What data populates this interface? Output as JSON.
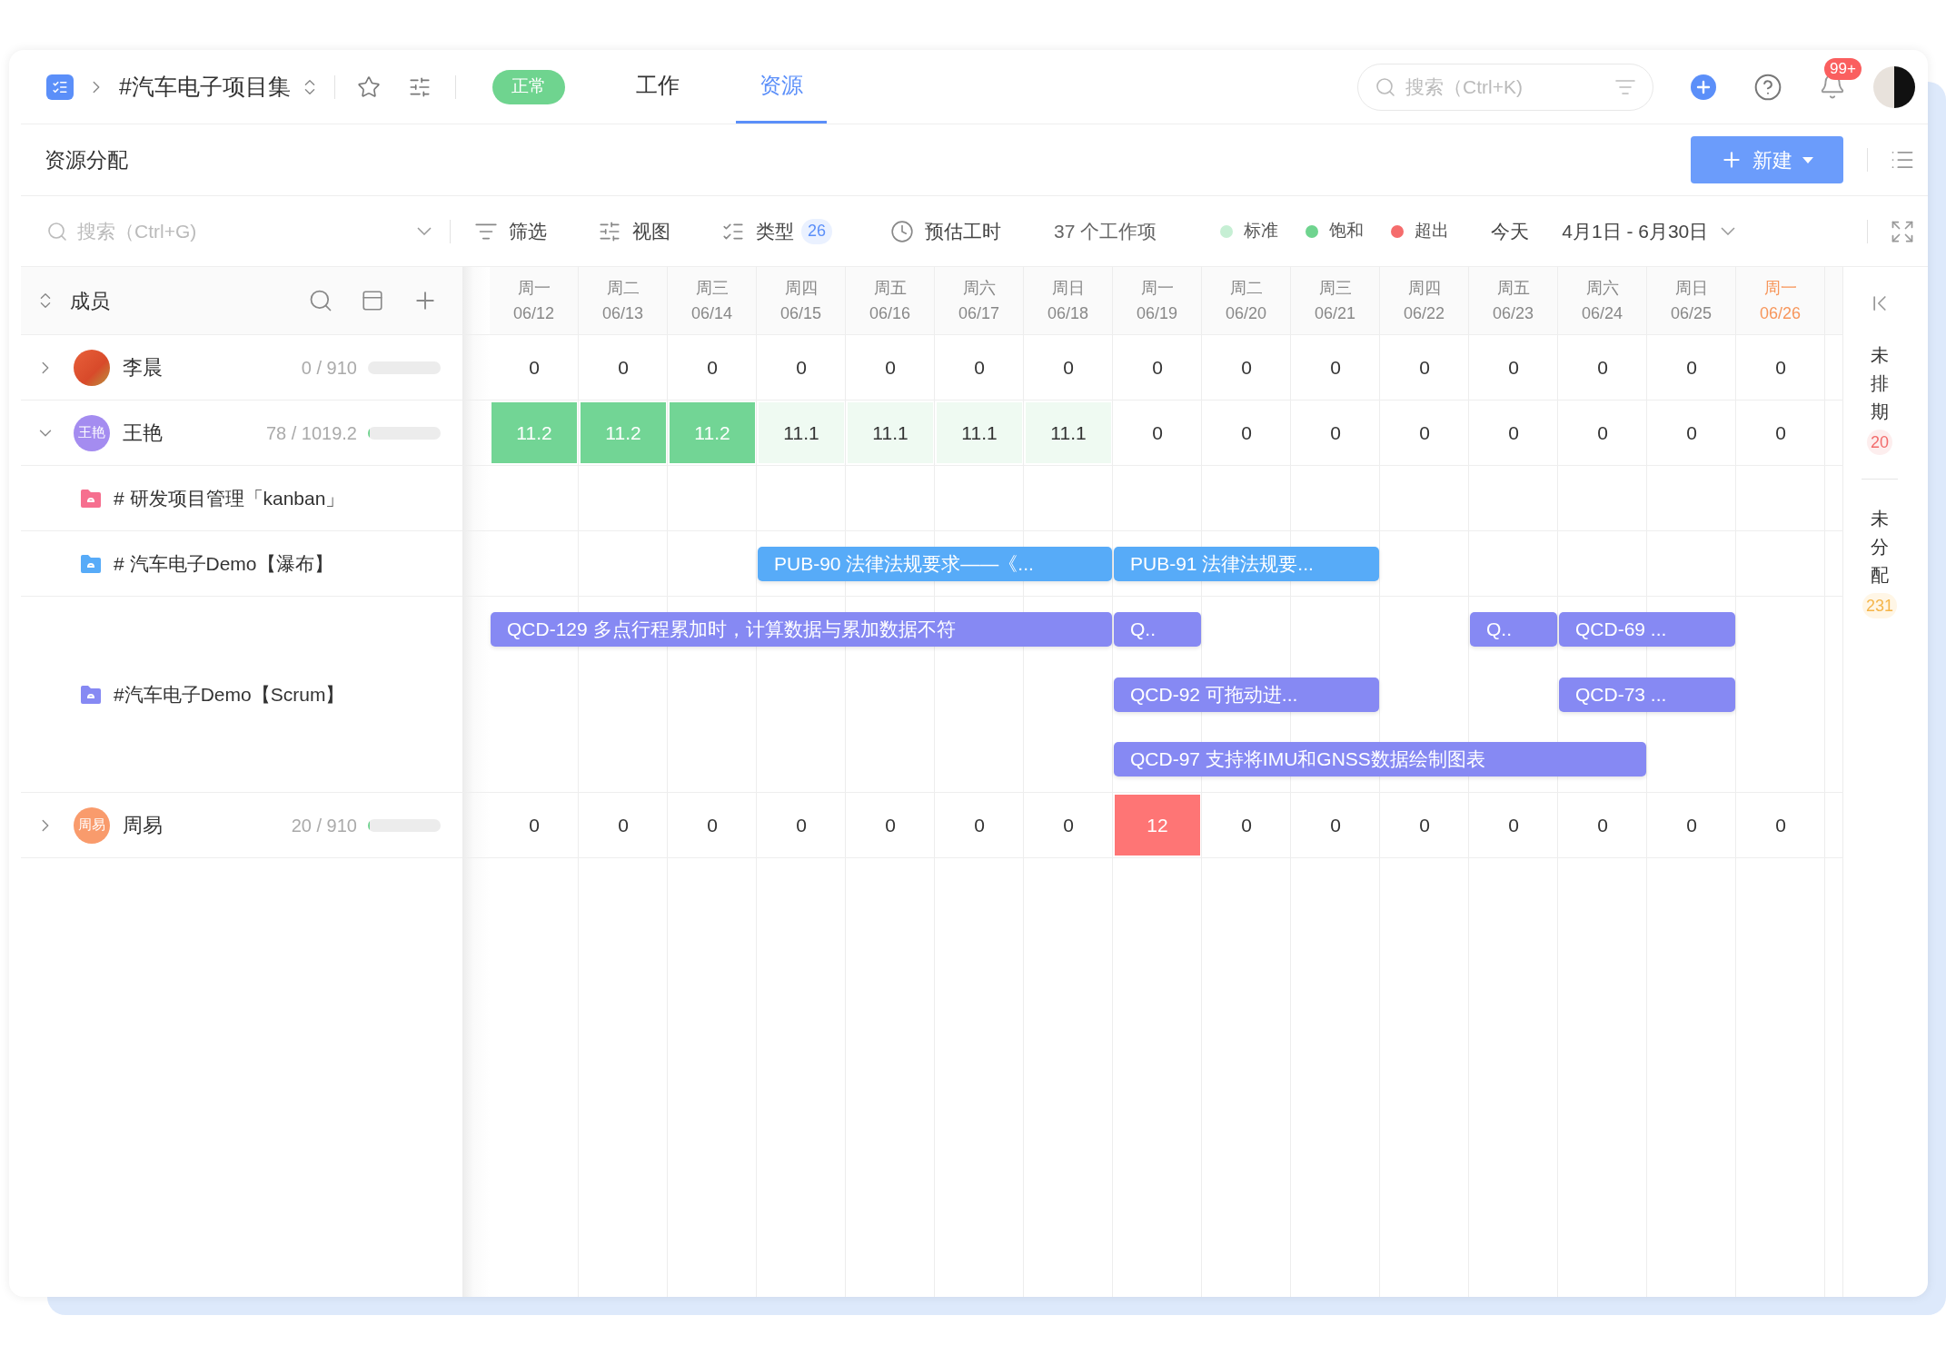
{
  "header": {
    "title": "#汽车电子项目集",
    "status": "正常",
    "tabs": [
      {
        "label": "工作",
        "selected": false
      },
      {
        "label": "资源",
        "selected": true
      }
    ],
    "search": {
      "placeholder": "搜索（Ctrl+K)"
    },
    "notification_badge": "99+"
  },
  "page_title": "资源分配",
  "new_button": "新建",
  "toolbar": {
    "search": {
      "placeholder": "搜索（Ctrl+G)"
    },
    "filter": "筛选",
    "view": "视图",
    "type": {
      "label": "类型",
      "count": "26"
    },
    "estimate": "预估工时",
    "item_count": "37 个工作项",
    "legend": [
      {
        "label": "标准",
        "color": "#c6efd4"
      },
      {
        "label": "饱和",
        "color": "#6fd48f"
      },
      {
        "label": "超出",
        "color": "#f56c6c"
      }
    ],
    "today": "今天",
    "date_range": "4月1日 - 6月30日"
  },
  "members_header": "成员",
  "days": [
    {
      "weekday": "周一",
      "date": "06/12",
      "today": false
    },
    {
      "weekday": "周二",
      "date": "06/13",
      "today": false
    },
    {
      "weekday": "周三",
      "date": "06/14",
      "today": false
    },
    {
      "weekday": "周四",
      "date": "06/15",
      "today": false
    },
    {
      "weekday": "周五",
      "date": "06/16",
      "today": false
    },
    {
      "weekday": "周六",
      "date": "06/17",
      "today": false
    },
    {
      "weekday": "周日",
      "date": "06/18",
      "today": false
    },
    {
      "weekday": "周一",
      "date": "06/19",
      "today": false
    },
    {
      "weekday": "周二",
      "date": "06/20",
      "today": false
    },
    {
      "weekday": "周三",
      "date": "06/21",
      "today": false
    },
    {
      "weekday": "周四",
      "date": "06/22",
      "today": false
    },
    {
      "weekday": "周五",
      "date": "06/23",
      "today": false
    },
    {
      "weekday": "周六",
      "date": "06/24",
      "today": false
    },
    {
      "weekday": "周日",
      "date": "06/25",
      "today": false
    },
    {
      "weekday": "周一",
      "date": "06/26",
      "today": true
    }
  ],
  "members": [
    {
      "name": "李晨",
      "avatar": {
        "kind": "photo"
      },
      "hours": "0 / 910",
      "expanded": false,
      "cells": [
        {
          "value": "0"
        },
        {
          "value": "0"
        },
        {
          "value": "0"
        },
        {
          "value": "0"
        },
        {
          "value": "0"
        },
        {
          "value": "0"
        },
        {
          "value": "0"
        },
        {
          "value": "0"
        },
        {
          "value": "0"
        },
        {
          "value": "0"
        },
        {
          "value": "0"
        },
        {
          "value": "0"
        },
        {
          "value": "0"
        },
        {
          "value": "0"
        },
        {
          "value": "0"
        }
      ]
    },
    {
      "name": "王艳",
      "avatar": {
        "kind": "initials",
        "text": "王艳",
        "color": "#a48cf0"
      },
      "hours": "78 / 1019.2",
      "level": 0.03,
      "expanded": true,
      "cells": [
        {
          "value": "11.2",
          "kind": "saturated"
        },
        {
          "value": "11.2",
          "kind": "saturated"
        },
        {
          "value": "11.2",
          "kind": "saturated"
        },
        {
          "value": "11.1",
          "kind": "standard"
        },
        {
          "value": "11.1",
          "kind": "standard"
        },
        {
          "value": "11.1",
          "kind": "standard"
        },
        {
          "value": "11.1",
          "kind": "standard"
        },
        {
          "value": "0"
        },
        {
          "value": "0"
        },
        {
          "value": "0"
        },
        {
          "value": "0"
        },
        {
          "value": "0"
        },
        {
          "value": "0"
        },
        {
          "value": "0"
        },
        {
          "value": "0"
        }
      ],
      "projects": [
        {
          "name": "# 研发项目管理「kanban」",
          "color": "#f66f8f"
        },
        {
          "name": "# 汽车电子Demo【瀑布】",
          "color": "#57abf8",
          "lanes": [
            [
              {
                "kind": "empty"
              },
              {
                "kind": "empty"
              },
              {
                "kind": "empty"
              },
              {
                "kind": "bar",
                "label": "PUB-90 法律法规要求——《..."
              },
              {
                "kind": "more"
              },
              {
                "kind": "more"
              },
              {
                "kind": "more"
              },
              {
                "kind": "bar",
                "label": "PUB-91 法律法规要..."
              },
              {
                "kind": "more"
              },
              {
                "kind": "more"
              },
              {
                "kind": "empty"
              },
              {
                "kind": "empty"
              },
              {
                "kind": "empty"
              },
              {
                "kind": "empty"
              },
              {
                "kind": "empty"
              }
            ]
          ]
        },
        {
          "name": "#汽车电子Demo【Scrum】",
          "color": "#8689f3",
          "lanes": [
            [
              {
                "kind": "bar",
                "label": "QCD-129 多点行程累加时，计算数据与累加数据不符"
              },
              {
                "kind": "more"
              },
              {
                "kind": "more"
              },
              {
                "kind": "more"
              },
              {
                "kind": "more"
              },
              {
                "kind": "more"
              },
              {
                "kind": "more"
              },
              {
                "kind": "bar",
                "label": "Q.."
              },
              {
                "kind": "empty"
              },
              {
                "kind": "empty"
              },
              {
                "kind": "empty"
              },
              {
                "kind": "bar",
                "label": "Q.."
              },
              {
                "kind": "bar",
                "label": "QCD-69 ..."
              },
              {
                "kind": "more"
              },
              {
                "kind": "empty"
              }
            ],
            [
              {
                "kind": "empty"
              },
              {
                "kind": "empty"
              },
              {
                "kind": "empty"
              },
              {
                "kind": "empty"
              },
              {
                "kind": "empty"
              },
              {
                "kind": "empty"
              },
              {
                "kind": "empty"
              },
              {
                "kind": "bar",
                "label": "QCD-92 可拖动进..."
              },
              {
                "kind": "more"
              },
              {
                "kind": "more"
              },
              {
                "kind": "empty"
              },
              {
                "kind": "empty"
              },
              {
                "kind": "bar",
                "label": "QCD-73 ..."
              },
              {
                "kind": "more"
              },
              {
                "kind": "empty"
              }
            ],
            [
              {
                "kind": "empty"
              },
              {
                "kind": "empty"
              },
              {
                "kind": "empty"
              },
              {
                "kind": "empty"
              },
              {
                "kind": "empty"
              },
              {
                "kind": "empty"
              },
              {
                "kind": "empty"
              },
              {
                "kind": "bar",
                "label": "QCD-97 支持将IMU和GNSS数据绘制图表"
              },
              {
                "kind": "more"
              },
              {
                "kind": "more"
              },
              {
                "kind": "more"
              },
              {
                "kind": "more"
              },
              {
                "kind": "more"
              },
              {
                "kind": "empty"
              },
              {
                "kind": "empty"
              }
            ]
          ]
        }
      ]
    },
    {
      "name": "周易",
      "avatar": {
        "kind": "initials",
        "text": "周易",
        "color": "#f99b6c"
      },
      "hours": "20 / 910",
      "level": 0.03,
      "expanded": false,
      "cells": [
        {
          "value": "0"
        },
        {
          "value": "0"
        },
        {
          "value": "0"
        },
        {
          "value": "0"
        },
        {
          "value": "0"
        },
        {
          "value": "0"
        },
        {
          "value": "0"
        },
        {
          "value": "12",
          "kind": "over"
        },
        {
          "value": "0"
        },
        {
          "value": "0"
        },
        {
          "value": "0"
        },
        {
          "value": "0"
        },
        {
          "value": "0"
        },
        {
          "value": "0"
        },
        {
          "value": "0"
        }
      ]
    }
  ],
  "side_panel": [
    {
      "label": "未排期",
      "count": "20",
      "kind": "unscheduled"
    },
    {
      "label": "未分配",
      "count": "231",
      "kind": "unassigned"
    }
  ]
}
